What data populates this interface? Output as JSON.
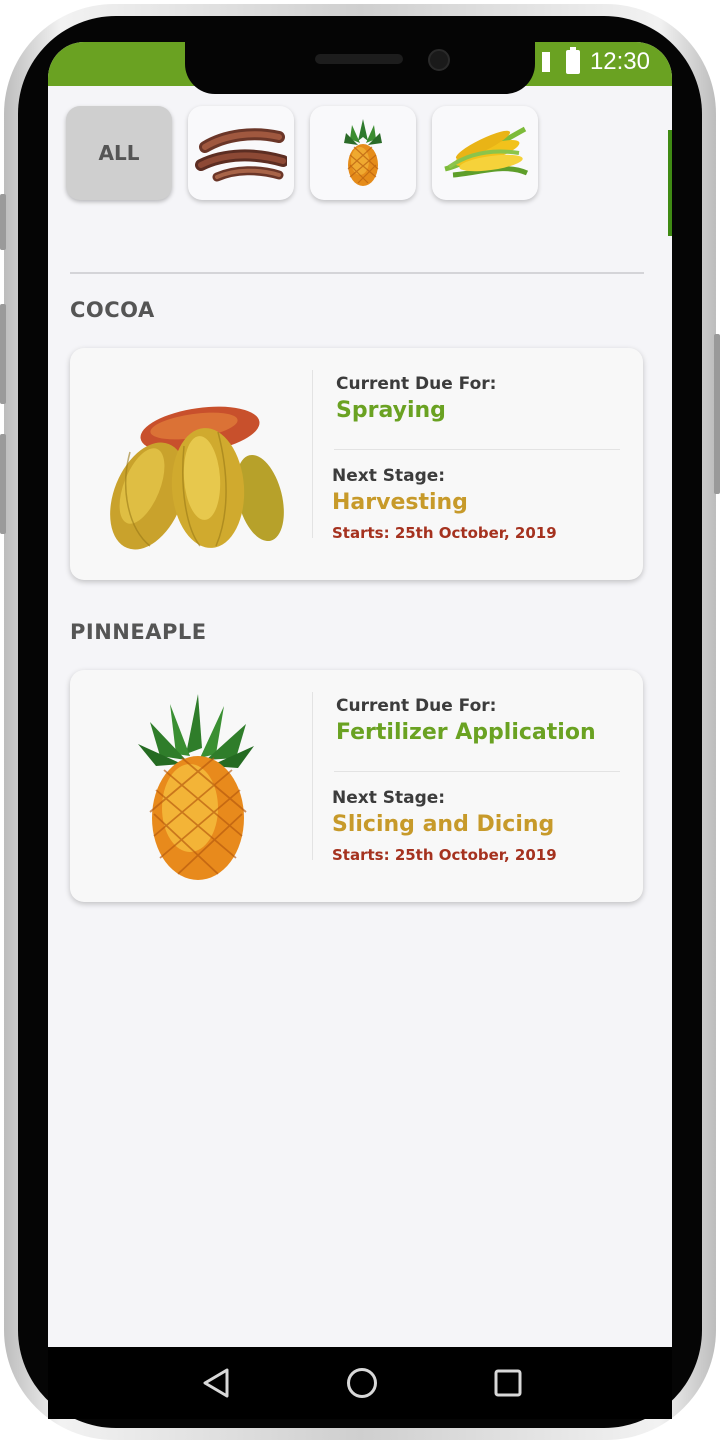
{
  "status_bar": {
    "time": "12:30"
  },
  "filter_tabs": [
    {
      "label": "ALL",
      "icon": "all-label"
    },
    {
      "label": "",
      "icon": "cassava-icon"
    },
    {
      "label": "",
      "icon": "pineapple-icon"
    },
    {
      "label": "",
      "icon": "corn-icon"
    }
  ],
  "crops": [
    {
      "name": "COCOA",
      "current_label": "Current Due For:",
      "current_value": "Spraying",
      "next_label": "Next Stage:",
      "next_value": "Harvesting",
      "starts": "Starts: 25th October, 2019"
    },
    {
      "name": "PINNEAPLE",
      "current_label": "Current Due For:",
      "current_value": "Fertilizer Application",
      "next_label": "Next Stage:",
      "next_value": "Slicing and Dicing",
      "starts": "Starts: 25th October, 2019"
    }
  ],
  "colors": {
    "status_bar": "#6aa222",
    "due_text": "#6aa222",
    "next_text": "#c79a2a",
    "starts_text": "#a5321f"
  },
  "nav_icons": [
    "back-icon",
    "home-icon",
    "recents-icon"
  ]
}
